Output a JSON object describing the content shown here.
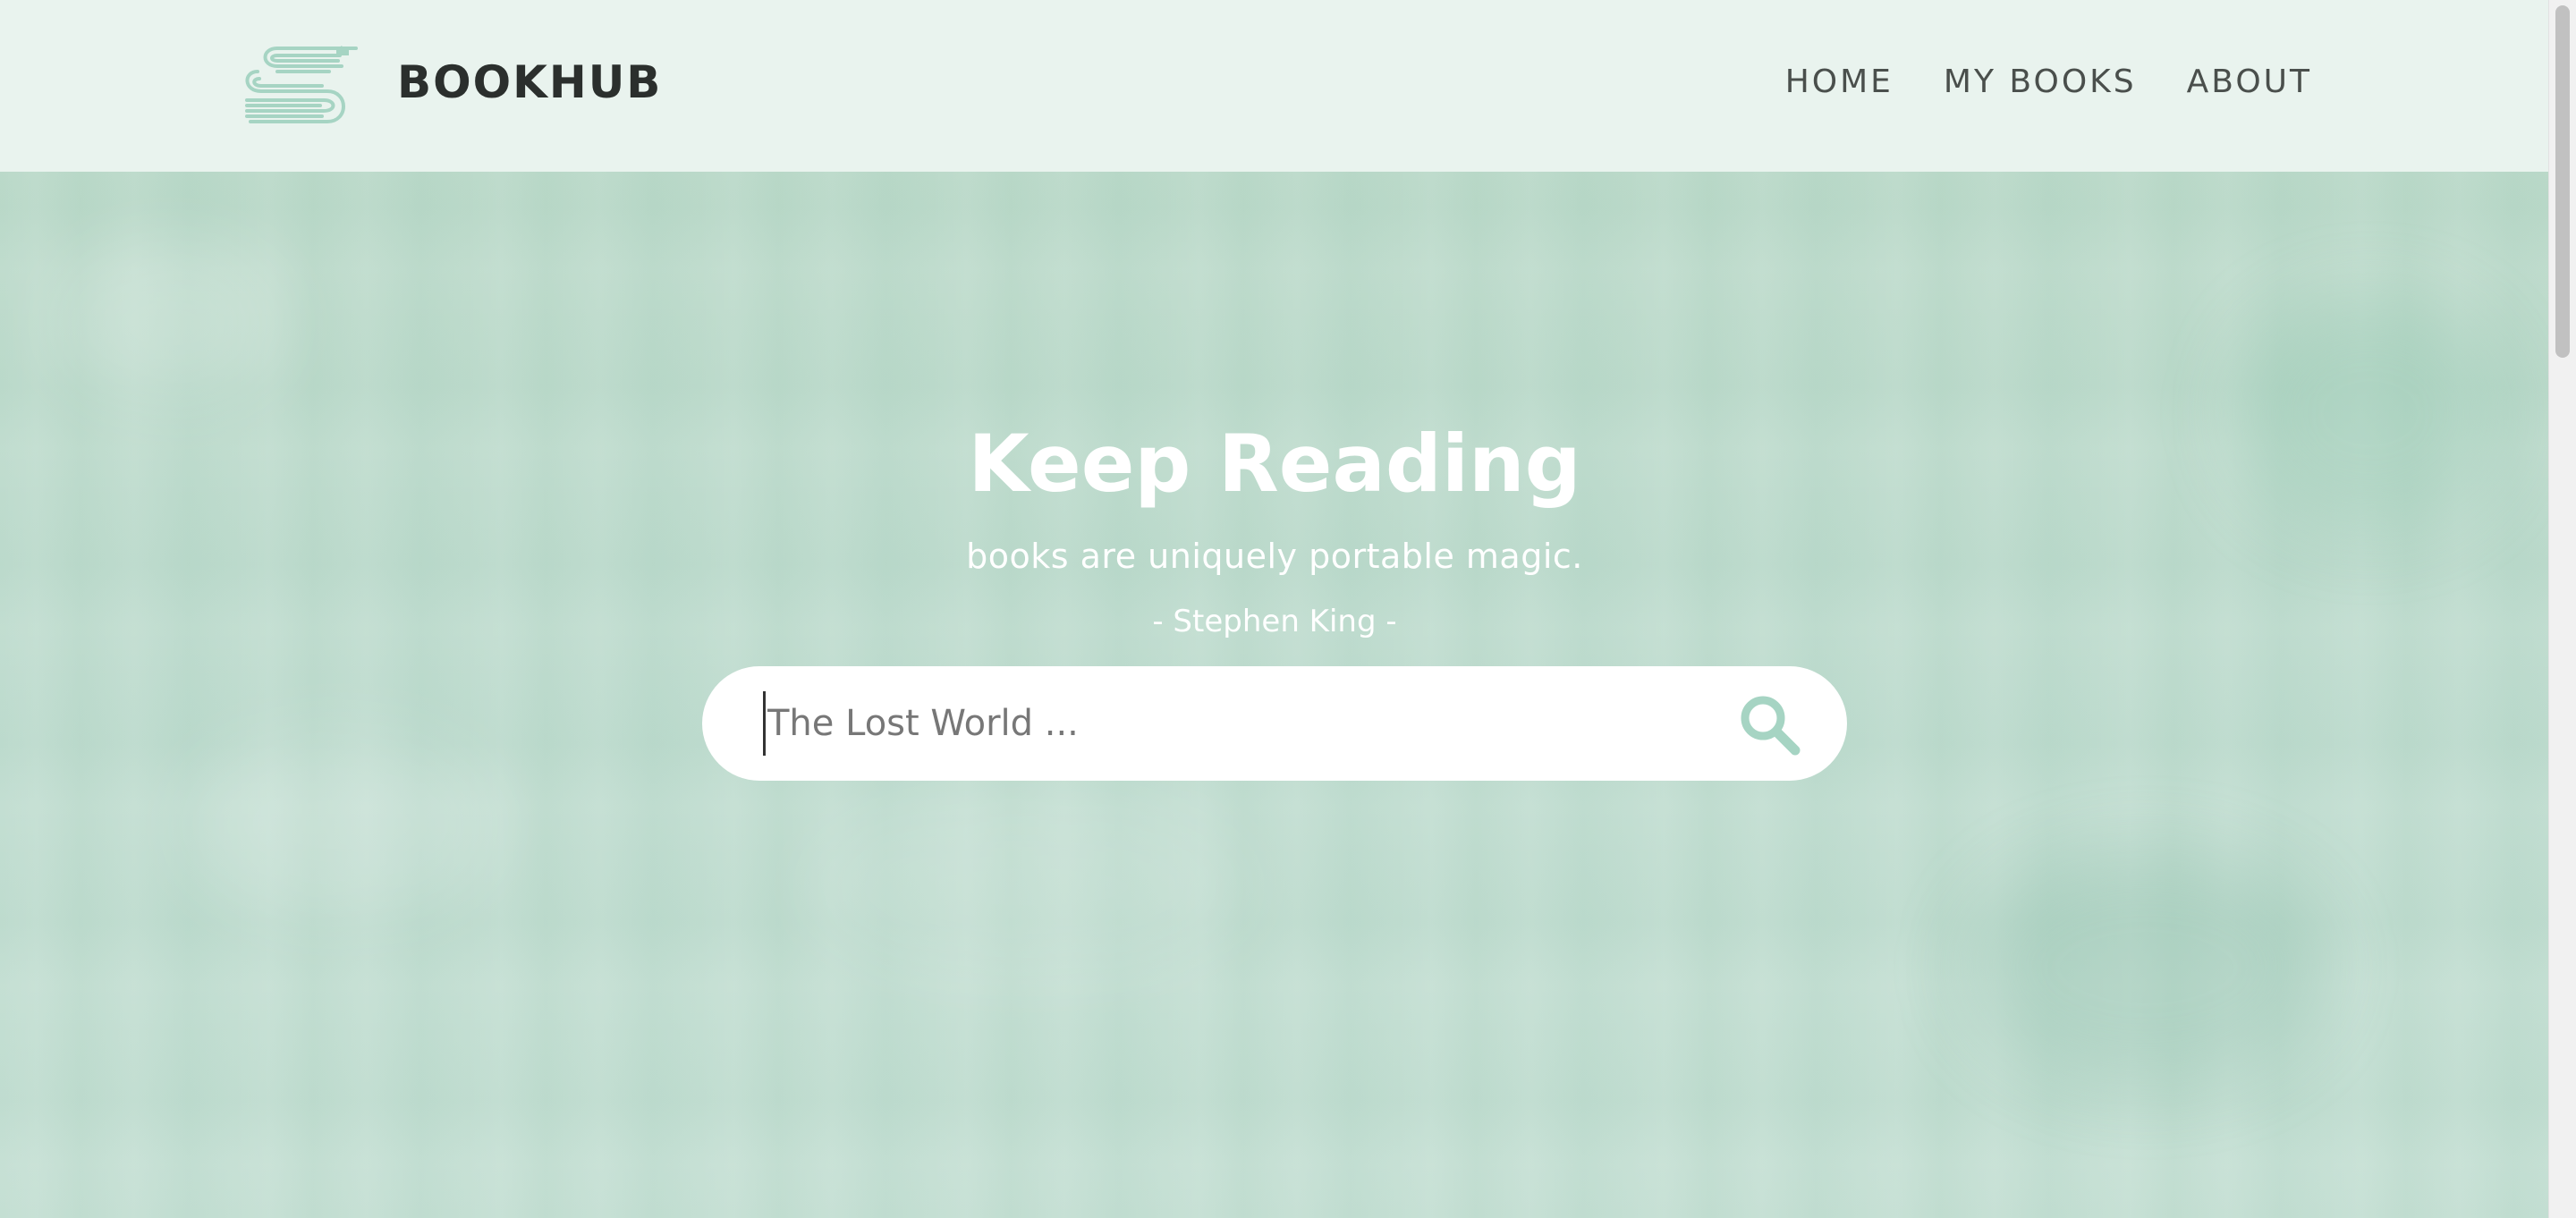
{
  "header": {
    "brand": "BOOKHUB",
    "logo_icon": "stacked-books-logo-icon",
    "nav": [
      {
        "label": "HOME"
      },
      {
        "label": "MY BOOKS"
      },
      {
        "label": "ABOUT"
      }
    ]
  },
  "hero": {
    "title": "Keep Reading",
    "quote": "books are uniquely portable magic.",
    "author": "- Stephen King -"
  },
  "search": {
    "placeholder": "The Lost World ...",
    "value": "",
    "icon": "search-icon"
  },
  "colors": {
    "header_bg": "#e9f3ee",
    "hero_bg": "#c1ddd0",
    "accent": "#a6d4c3",
    "brand_text": "#2b2f2d",
    "nav_text": "#4a4f4c"
  }
}
